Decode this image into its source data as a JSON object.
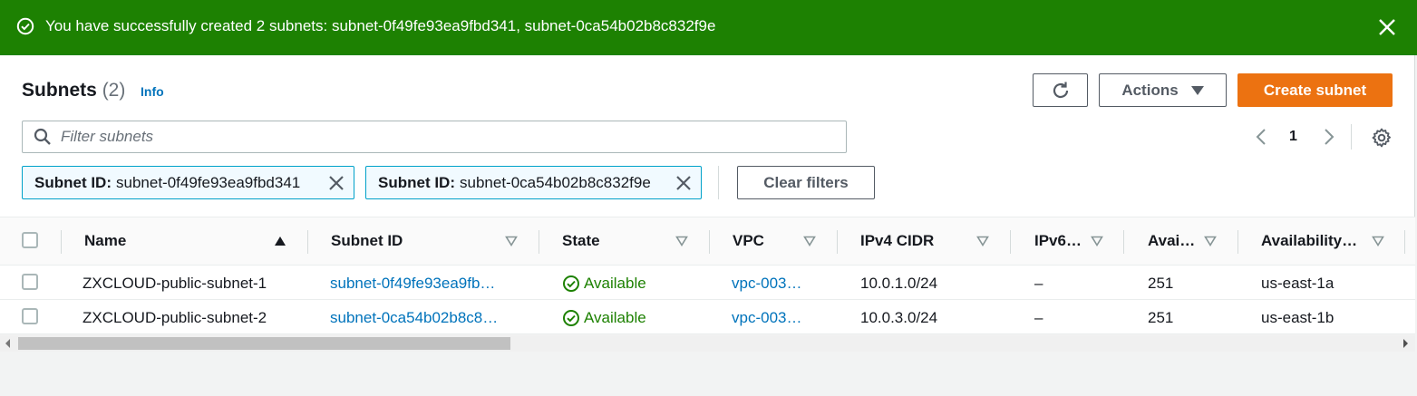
{
  "flash": {
    "message": "You have successfully created 2 subnets: subnet-0f49fe93ea9fbd341, subnet-0ca54b02b8c832f9e",
    "color": "#1d8102"
  },
  "header": {
    "title": "Subnets",
    "count": "(2)",
    "info": "Info"
  },
  "buttons": {
    "actions": "Actions",
    "create": "Create subnet",
    "clear_filters": "Clear filters"
  },
  "search": {
    "placeholder": "Filter subnets"
  },
  "pagination": {
    "current_page": "1"
  },
  "filters": [
    {
      "key": "Subnet ID:",
      "value": "subnet-0f49fe93ea9fbd341"
    },
    {
      "key": "Subnet ID:",
      "value": "subnet-0ca54b02b8c832f9e"
    }
  ],
  "table": {
    "columns": [
      "Name",
      "Subnet ID",
      "State",
      "VPC",
      "IPv4 CIDR",
      "IPv6…",
      "Avai…",
      "Availability…"
    ],
    "rows": [
      {
        "name": "ZXCLOUD-public-subnet-1",
        "subnet_id": "subnet-0f49fe93ea9fb…",
        "state": "Available",
        "vpc": "vpc-003…",
        "ipv4_cidr": "10.0.1.0/24",
        "ipv6": "–",
        "available_ips": "251",
        "availability_zone": "us-east-1a"
      },
      {
        "name": "ZXCLOUD-public-subnet-2",
        "subnet_id": "subnet-0ca54b02b8c8…",
        "state": "Available",
        "vpc": "vpc-003…",
        "ipv4_cidr": "10.0.3.0/24",
        "ipv6": "–",
        "available_ips": "251",
        "availability_zone": "us-east-1b"
      }
    ]
  },
  "colors": {
    "accent": "#ec7211",
    "link": "#0073bb",
    "success": "#1d8102"
  },
  "icons": {
    "flash": "check-circle-icon",
    "close": "close-icon",
    "refresh": "refresh-icon",
    "dropdown": "caret-down-icon",
    "search": "search-icon",
    "settings": "gear-icon"
  }
}
